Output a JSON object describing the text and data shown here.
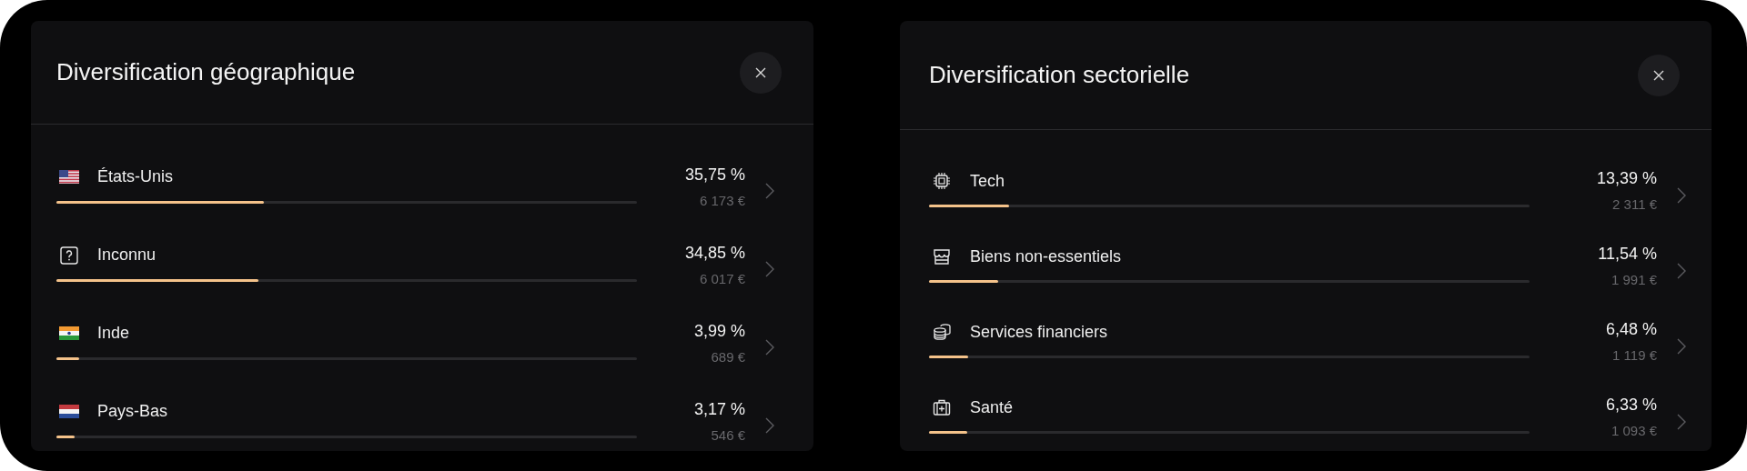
{
  "panels": [
    {
      "title": "Diversification géographique",
      "items": [
        {
          "kind": "flag-us",
          "label": "États-Unis",
          "percent": "35,75 %",
          "amount": "6 173 €",
          "level": 0.3575
        },
        {
          "kind": "unknown",
          "label": "Inconnu",
          "percent": "34,85 %",
          "amount": "6 017 €",
          "level": 0.3485
        },
        {
          "kind": "flag-in",
          "label": "Inde",
          "percent": "3,99 %",
          "amount": "689 €",
          "level": 0.0399
        },
        {
          "kind": "flag-nl",
          "label": "Pays-Bas",
          "percent": "3,17 %",
          "amount": "546 €",
          "level": 0.0317
        }
      ]
    },
    {
      "title": "Diversification sectorielle",
      "items": [
        {
          "kind": "chip",
          "label": "Tech",
          "percent": "13,39 %",
          "amount": "2 311 €",
          "level": 0.1339
        },
        {
          "kind": "store",
          "label": "Biens non-essentiels",
          "percent": "11,54 %",
          "amount": "1 991 €",
          "level": 0.1154
        },
        {
          "kind": "coins",
          "label": "Services financiers",
          "percent": "6,48 %",
          "amount": "1 119 €",
          "level": 0.0648
        },
        {
          "kind": "medical",
          "label": "Santé",
          "percent": "6,33 %",
          "amount": "1 093 €",
          "level": 0.0633
        }
      ]
    }
  ]
}
